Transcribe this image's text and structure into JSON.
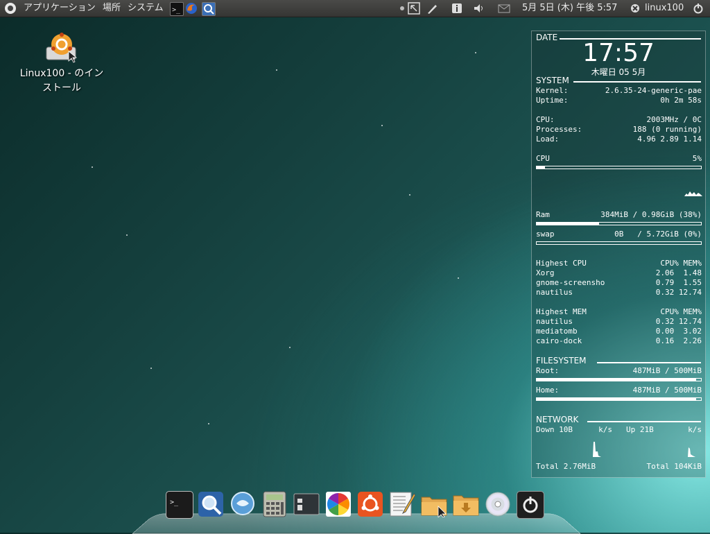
{
  "panel": {
    "menus": [
      "アプリケーション",
      "場所",
      "システム"
    ],
    "clock": "5月 5日 (木) 午後 5:57",
    "username": "linux100",
    "colors": {
      "panel_bg": "#3f3f3d",
      "panel_text": "#eaeaea"
    }
  },
  "desktop": {
    "icon_label_line1": "Linux100 - のイン",
    "icon_label_line2": "ストール"
  },
  "conky": {
    "date_header": "DATE",
    "time": "17:57",
    "date_line": "木曜日 05 5月",
    "system_header": "SYSTEM",
    "system_rows": [
      {
        "label": "Kernel:",
        "value": "2.6.35-24-generic-pae"
      },
      {
        "label": "Uptime:",
        "value": "0h 2m 58s"
      },
      {
        "label": "CPU:",
        "value": "2003MHz / 0C"
      },
      {
        "label": "Processes:",
        "value": "188 (0 running)"
      },
      {
        "label": "Load:",
        "value": "4.96 2.89 1.14"
      }
    ],
    "cpu_label": "CPU",
    "cpu_value": "5%",
    "cpu_percent": 5,
    "ram_label": "Ram",
    "ram_value": "384MiB / 0.98GiB (38%)",
    "ram_percent": 38,
    "swap_label": "swap",
    "swap_value": "0B   / 5.72GiB (0%)",
    "swap_percent": 0,
    "highest_cpu": {
      "header": "Highest CPU",
      "cols": "CPU% MEM%",
      "rows": [
        {
          "name": "Xorg",
          "value": "2.06  1.48"
        },
        {
          "name": "gnome-screensho",
          "value": "0.79  1.55"
        },
        {
          "name": "nautilus",
          "value": "0.32 12.74"
        }
      ]
    },
    "highest_mem": {
      "header": "Highest MEM",
      "cols": "CPU% MEM%",
      "rows": [
        {
          "name": "nautilus",
          "value": "0.32 12.74"
        },
        {
          "name": "mediatomb",
          "value": "0.00  3.02"
        },
        {
          "name": "cairo-dock",
          "value": "0.16  2.26"
        }
      ]
    },
    "filesystem_header": "FILESYSTEM",
    "fs_root_label": "Root:",
    "fs_root_value": "487MiB / 500MiB",
    "fs_root_percent": 97,
    "fs_home_label": "Home:",
    "fs_home_value": "487MiB / 500MiB",
    "fs_home_percent": 97,
    "network_header": "NETWORK",
    "down_label": "Down 10B",
    "down_unit": "k/s",
    "up_label": "Up 21B",
    "up_unit": "k/s",
    "total_down": "Total 2.76MiB",
    "total_up": "Total 104KiB"
  },
  "dock": {
    "apps": [
      "terminal-icon",
      "browser-icon",
      "chat-icon",
      "calculator-icon",
      "window-icon",
      "color-wheel-icon",
      "ubuntu-software-icon",
      "text-editor-icon",
      "folder-icon",
      "downloads-folder-icon",
      "cd-icon",
      "power-icon"
    ]
  }
}
